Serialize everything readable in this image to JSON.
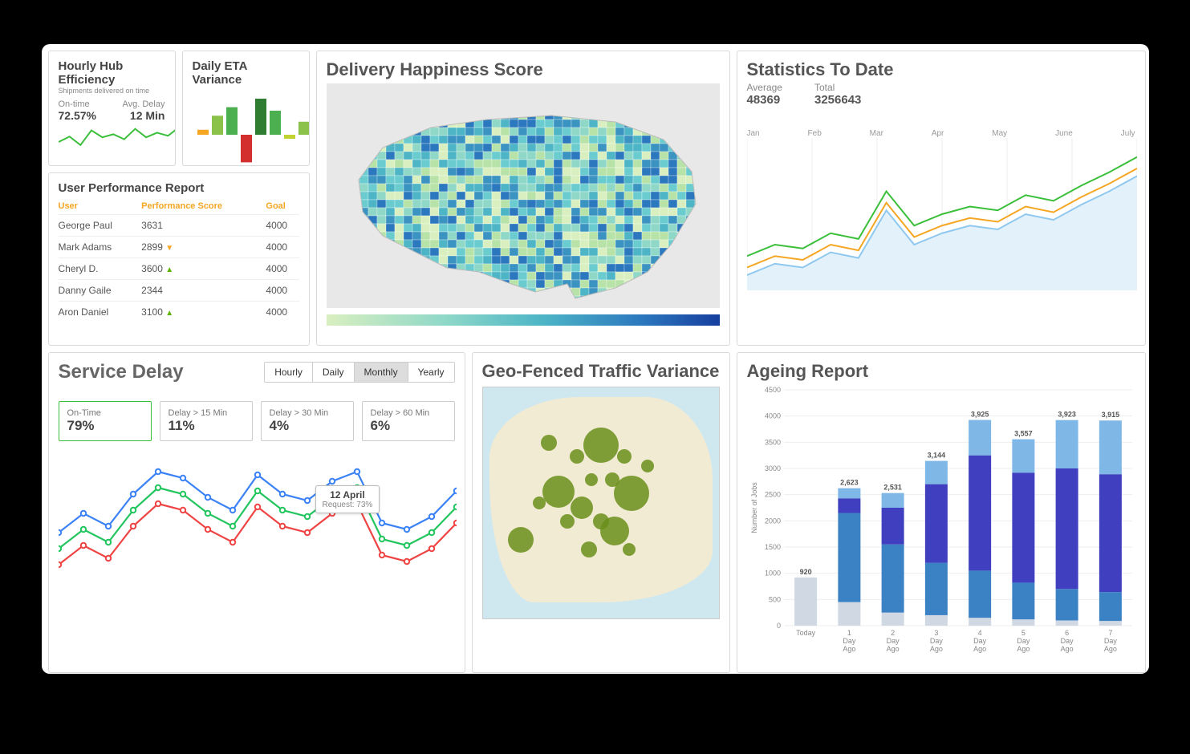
{
  "hub": {
    "title": "Hourly Hub Efficiency",
    "subtitle": "Shipments delivered on time",
    "ontime_label": "On-time",
    "ontime_value": "72.57%",
    "delay_label": "Avg. Delay",
    "delay_value": "12 Min"
  },
  "eta": {
    "title": "Daily ETA Variance"
  },
  "upr": {
    "title": "User Performance Report",
    "cols": {
      "user": "User",
      "score": "Performance Score",
      "goal": "Goal"
    },
    "rows": [
      {
        "user": "George Paul",
        "score": "3631",
        "trend": "",
        "goal": "4000"
      },
      {
        "user": "Mark Adams",
        "score": "2899",
        "trend": "dn",
        "goal": "4000"
      },
      {
        "user": "Cheryl D.",
        "score": "3600",
        "trend": "up",
        "goal": "4000"
      },
      {
        "user": "Danny Gaile",
        "score": "2344",
        "trend": "",
        "goal": "4000"
      },
      {
        "user": "Aron Daniel",
        "score": "3100",
        "trend": "up",
        "goal": "4000"
      }
    ]
  },
  "happy": {
    "title": "Delivery Happiness Score"
  },
  "stats": {
    "title": "Statistics To Date",
    "avg_label": "Average",
    "avg_value": "48369",
    "tot_label": "Total",
    "tot_value": "3256643",
    "months": [
      "Jan",
      "Feb",
      "Mar",
      "Apr",
      "May",
      "June",
      "July"
    ]
  },
  "delay": {
    "title": "Service Delay",
    "segments": [
      "Hourly",
      "Daily",
      "Monthly",
      "Yearly"
    ],
    "active_segment": "Monthly",
    "metrics": [
      {
        "label": "On-Time",
        "value": "79%",
        "selected": true
      },
      {
        "label": "Delay > 15 Min",
        "value": "11%",
        "selected": false
      },
      {
        "label": "Delay > 30 Min",
        "value": "4%",
        "selected": false
      },
      {
        "label": "Delay > 60 Min",
        "value": "6%",
        "selected": false
      }
    ],
    "tooltip": {
      "date": "12 April",
      "request": "Request: 73%"
    }
  },
  "geo": {
    "title": "Geo-Fenced Traffic Variance"
  },
  "ageing": {
    "title": "Ageing Report",
    "ylabel": "Number of Jobs"
  },
  "chart_data": [
    {
      "id": "hourly_hub_sparkline",
      "type": "line",
      "values": [
        48,
        62,
        40,
        78,
        60,
        68,
        55,
        82,
        60,
        72,
        64,
        86
      ],
      "ylim": [
        0,
        100
      ],
      "color": "#3bbf3b"
    },
    {
      "id": "daily_eta_variance",
      "type": "bar",
      "categories": [
        "1",
        "2",
        "3",
        "4",
        "5",
        "6",
        "7",
        "8"
      ],
      "values": [
        10,
        38,
        55,
        -55,
        72,
        48,
        -8,
        26
      ],
      "colors": [
        "#f5a623",
        "#8bc34a",
        "#4caf50",
        "#d32f2f",
        "#2e7d32",
        "#4caf50",
        "#c0d330",
        "#8bc34a"
      ],
      "ylim": [
        -60,
        80
      ]
    },
    {
      "id": "statistics_to_date",
      "type": "line",
      "x": [
        "Jan",
        "Feb",
        "Mar",
        "Apr",
        "May",
        "June",
        "July"
      ],
      "series": [
        {
          "name": "green",
          "color": "#3bbf3b",
          "values": [
            18,
            24,
            22,
            30,
            27,
            52,
            34,
            40,
            44,
            42,
            50,
            47,
            55,
            62,
            70
          ]
        },
        {
          "name": "orange",
          "color": "#f5a623",
          "values": [
            12,
            18,
            16,
            24,
            21,
            46,
            28,
            34,
            38,
            36,
            44,
            41,
            49,
            56,
            64
          ]
        },
        {
          "name": "blue",
          "color": "#8fc8ef",
          "values": [
            8,
            14,
            12,
            20,
            17,
            42,
            24,
            30,
            34,
            32,
            40,
            37,
            45,
            52,
            60
          ]
        }
      ],
      "ylim": [
        0,
        80
      ]
    },
    {
      "id": "service_delay",
      "type": "line",
      "x": [
        1,
        2,
        3,
        4,
        5,
        6,
        7,
        8,
        9,
        10,
        11,
        12,
        13,
        14,
        15,
        16,
        17
      ],
      "series": [
        {
          "name": "blue",
          "color": "#3b82f6",
          "values": [
            46,
            58,
            50,
            70,
            84,
            80,
            68,
            60,
            82,
            70,
            66,
            78,
            84,
            52,
            48,
            56,
            72
          ]
        },
        {
          "name": "green",
          "color": "#22c55e",
          "values": [
            36,
            48,
            40,
            60,
            74,
            70,
            58,
            50,
            72,
            60,
            56,
            68,
            74,
            42,
            38,
            46,
            62
          ]
        },
        {
          "name": "red",
          "color": "#ef4444",
          "values": [
            26,
            38,
            30,
            50,
            64,
            60,
            48,
            40,
            62,
            50,
            46,
            58,
            64,
            32,
            28,
            36,
            52
          ]
        }
      ],
      "ylim": [
        0,
        100
      ],
      "tooltip_point": {
        "x": 13,
        "series": "green",
        "label": "12 April",
        "detail": "Request: 73%"
      }
    },
    {
      "id": "geo_fenced_traffic",
      "type": "scatter",
      "note": "bubble map — x,y in % of panel, r in px",
      "points": [
        {
          "x": 50,
          "y": 25,
          "r": 22
        },
        {
          "x": 63,
          "y": 46,
          "r": 22
        },
        {
          "x": 32,
          "y": 45,
          "r": 20
        },
        {
          "x": 42,
          "y": 52,
          "r": 14
        },
        {
          "x": 16,
          "y": 66,
          "r": 16
        },
        {
          "x": 56,
          "y": 62,
          "r": 18
        },
        {
          "x": 45,
          "y": 70,
          "r": 10
        },
        {
          "x": 28,
          "y": 24,
          "r": 10
        },
        {
          "x": 40,
          "y": 30,
          "r": 9
        },
        {
          "x": 60,
          "y": 30,
          "r": 9
        },
        {
          "x": 70,
          "y": 34,
          "r": 8
        },
        {
          "x": 55,
          "y": 40,
          "r": 9
        },
        {
          "x": 36,
          "y": 58,
          "r": 9
        },
        {
          "x": 50,
          "y": 58,
          "r": 10
        },
        {
          "x": 62,
          "y": 70,
          "r": 8
        },
        {
          "x": 24,
          "y": 50,
          "r": 8
        },
        {
          "x": 46,
          "y": 40,
          "r": 8
        }
      ]
    },
    {
      "id": "ageing_report",
      "type": "bar",
      "stacked": true,
      "ylabel": "Number of Jobs",
      "ylim": [
        0,
        4500
      ],
      "yticks": [
        0,
        500,
        1000,
        1500,
        2000,
        2500,
        3000,
        3500,
        4000,
        4500
      ],
      "categories": [
        "Today",
        "1 Day Ago",
        "2 Day Ago",
        "3 Day Ago",
        "4 Day Ago",
        "5 Day Ago",
        "6 Day Ago",
        "7 Day Ago"
      ],
      "totals": [
        920,
        2623,
        2531,
        3144,
        3925,
        3557,
        3923,
        3915
      ],
      "series": [
        {
          "name": "a",
          "color": "#cfd8e3",
          "values": [
            920,
            450,
            250,
            200,
            150,
            120,
            100,
            90
          ]
        },
        {
          "name": "b",
          "color": "#3b82c4",
          "values": [
            0,
            1700,
            1300,
            1000,
            900,
            700,
            600,
            550
          ]
        },
        {
          "name": "c",
          "color": "#3f3fbf",
          "values": [
            0,
            280,
            700,
            1500,
            2200,
            2100,
            2300,
            2250
          ]
        },
        {
          "name": "d",
          "color": "#7fb8e6",
          "values": [
            0,
            193,
            281,
            444,
            675,
            637,
            923,
            1025
          ]
        }
      ]
    }
  ]
}
